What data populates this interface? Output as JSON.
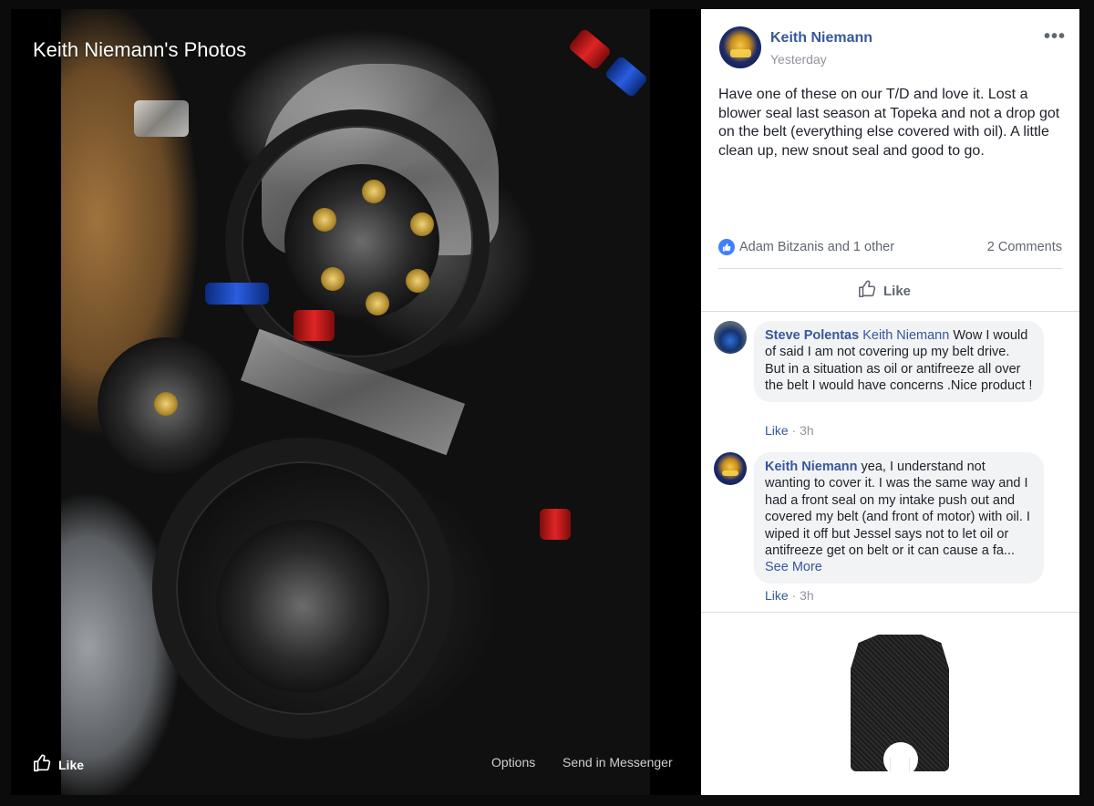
{
  "viewer": {
    "title": "Keith Niemann's Photos",
    "like_label": "Like",
    "options_label": "Options",
    "send_label": "Send in Messenger"
  },
  "post": {
    "author": "Keith Niemann",
    "time": "Yesterday",
    "more_icon": "•••",
    "text": "Have one of these on our T/D and love it. Lost a blower seal last season at Topeka and not a drop got on the belt (everything else covered with oil). A little clean up, new snout seal and good to go.",
    "reactions": "Adam Bitzanis and 1 other",
    "comments_count": "2 Comments",
    "like_label": "Like"
  },
  "comments": [
    {
      "name": "Steve Polentas",
      "tag": "Keith Niemann",
      "text": " Wow I would of said I am not covering up my belt drive. But in a situation as oil or antifreeze all over the belt I would have concerns .Nice product !",
      "like": "Like",
      "time": " · 3h"
    },
    {
      "name": "Keith Niemann",
      "text": " yea, I understand not wanting to cover it. I was the same way and I had a front seal on my intake push out and covered my belt (and front of motor) with oil. I wiped it off but Jessel says not to let oil or antifreeze get on belt or it can cause a fa...",
      "see_more": "See More",
      "like": "Like",
      "time": " · 3h"
    }
  ],
  "colors": {
    "link": "#365899",
    "like_blue": "#4080ff",
    "muted": "#90949c"
  }
}
